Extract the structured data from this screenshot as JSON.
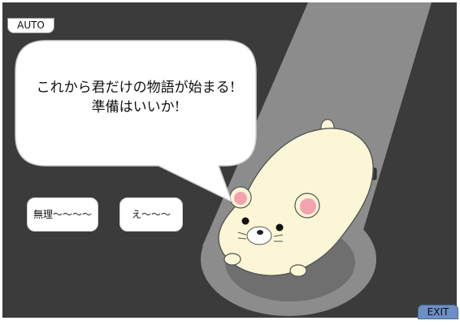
{
  "controls": {
    "auto_label": "AUTO",
    "exit_label": "EXIT"
  },
  "dialogue": {
    "line1": "これから君だけの物語が始まる!",
    "line2": "準備はいいか!"
  },
  "choices": [
    {
      "label": "無理〜〜〜〜"
    },
    {
      "label": "え〜〜〜"
    }
  ],
  "colors": {
    "background": "#3b3b3b",
    "spotlight": "#8c8c8c",
    "character_body": "#fbf6d5",
    "cheek": "#f3a3b0",
    "exit_button": "#6e8fc2"
  }
}
